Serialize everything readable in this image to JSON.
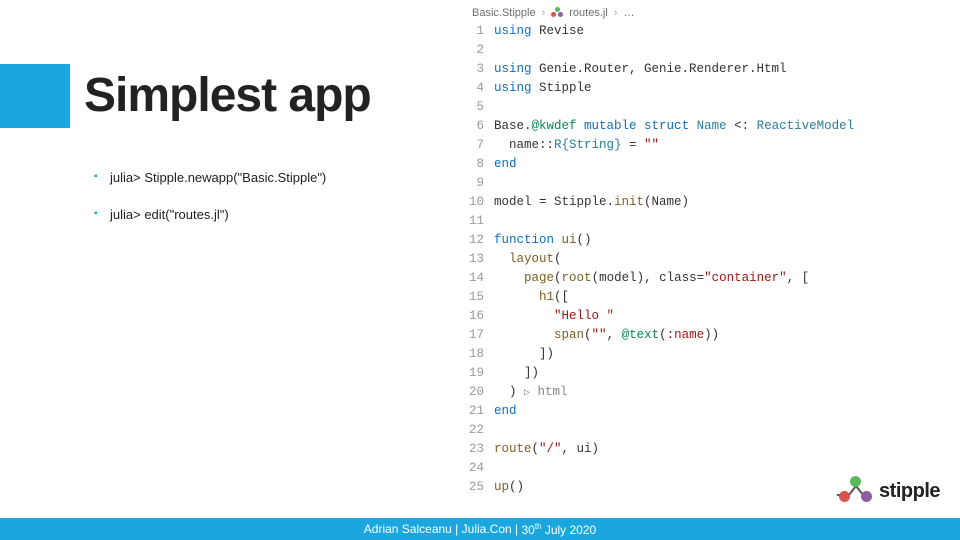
{
  "title": "Simplest app",
  "bullets": [
    "julia> Stipple.newapp(\"Basic.Stipple\")",
    "julia> edit(\"routes.jl\")"
  ],
  "breadcrumb": {
    "seg1": "Basic.Stipple",
    "seg2": "routes.jl",
    "seg3": "…"
  },
  "code": {
    "lines": [
      {
        "n": 1,
        "t": [
          [
            "kw",
            "using"
          ],
          [
            "",
            " Revise"
          ]
        ]
      },
      {
        "n": 2,
        "t": [
          [
            "",
            ""
          ]
        ]
      },
      {
        "n": 3,
        "t": [
          [
            "kw",
            "using"
          ],
          [
            "",
            " Genie.Router, Genie.Renderer.Html"
          ]
        ]
      },
      {
        "n": 4,
        "t": [
          [
            "kw",
            "using"
          ],
          [
            "",
            " Stipple"
          ]
        ]
      },
      {
        "n": 5,
        "t": [
          [
            "",
            ""
          ]
        ]
      },
      {
        "n": 6,
        "t": [
          [
            "",
            "Base."
          ],
          [
            "mac",
            "@kwdef"
          ],
          [
            "",
            " "
          ],
          [
            "kw",
            "mutable struct"
          ],
          [
            "",
            " "
          ],
          [
            "ty",
            "Name"
          ],
          [
            "",
            " <: "
          ],
          [
            "ty",
            "ReactiveModel"
          ]
        ]
      },
      {
        "n": 7,
        "t": [
          [
            "",
            "  name::"
          ],
          [
            "r-type",
            "R{String}"
          ],
          [
            "",
            " = "
          ],
          [
            "str",
            "\"\""
          ]
        ]
      },
      {
        "n": 8,
        "t": [
          [
            "kw",
            "end"
          ]
        ]
      },
      {
        "n": 9,
        "t": [
          [
            "",
            ""
          ]
        ]
      },
      {
        "n": 10,
        "t": [
          [
            "",
            "model = Stipple."
          ],
          [
            "fn",
            "init"
          ],
          [
            "",
            "(Name)"
          ]
        ]
      },
      {
        "n": 11,
        "t": [
          [
            "",
            ""
          ]
        ]
      },
      {
        "n": 12,
        "t": [
          [
            "kw",
            "function"
          ],
          [
            "",
            " "
          ],
          [
            "fn",
            "ui"
          ],
          [
            "",
            "()"
          ]
        ]
      },
      {
        "n": 13,
        "t": [
          [
            "",
            "  "
          ],
          [
            "fn",
            "layout"
          ],
          [
            "",
            "("
          ]
        ]
      },
      {
        "n": 14,
        "t": [
          [
            "",
            "    "
          ],
          [
            "fn",
            "page"
          ],
          [
            "",
            "("
          ],
          [
            "fn",
            "root"
          ],
          [
            "",
            "(model), class="
          ],
          [
            "str",
            "\"container\""
          ],
          [
            "",
            ", ["
          ]
        ]
      },
      {
        "n": 15,
        "t": [
          [
            "",
            "      "
          ],
          [
            "fn",
            "h1"
          ],
          [
            "",
            "(["
          ]
        ]
      },
      {
        "n": 16,
        "t": [
          [
            "",
            "        "
          ],
          [
            "str",
            "\"Hello \""
          ]
        ]
      },
      {
        "n": 17,
        "t": [
          [
            "",
            "        "
          ],
          [
            "fn",
            "span"
          ],
          [
            "",
            "("
          ],
          [
            "str",
            "\"\""
          ],
          [
            "",
            ", "
          ],
          [
            "mac",
            "@text"
          ],
          [
            "",
            "("
          ],
          [
            "str",
            ":name"
          ],
          [
            "",
            "))"
          ]
        ]
      },
      {
        "n": 18,
        "t": [
          [
            "",
            "      ])"
          ]
        ]
      },
      {
        "n": 19,
        "t": [
          [
            "",
            "    ])"
          ]
        ]
      },
      {
        "n": 20,
        "t": [
          [
            "",
            "  ) "
          ],
          [
            "play",
            "▷"
          ],
          [
            "pale",
            " html"
          ]
        ]
      },
      {
        "n": 21,
        "t": [
          [
            "kw",
            "end"
          ]
        ]
      },
      {
        "n": 22,
        "t": [
          [
            "",
            ""
          ]
        ]
      },
      {
        "n": 23,
        "t": [
          [
            "fn",
            "route"
          ],
          [
            "",
            "("
          ],
          [
            "str",
            "\"/\""
          ],
          [
            "",
            ", ui)"
          ]
        ]
      },
      {
        "n": 24,
        "t": [
          [
            "",
            ""
          ]
        ]
      },
      {
        "n": 25,
        "t": [
          [
            "fn",
            "up"
          ],
          [
            "",
            "()"
          ]
        ]
      }
    ]
  },
  "footer": {
    "author": "Adrian Salceanu",
    "event": "Julia.Con",
    "date_prefix": "30",
    "date_suffix": "th",
    "date_rest": " July 2020"
  },
  "brand": "stipple",
  "colors": {
    "accent": "#1aa6de",
    "dot_red": "#d9534f",
    "dot_green": "#5cb85c",
    "dot_purple": "#8e5ea2"
  }
}
